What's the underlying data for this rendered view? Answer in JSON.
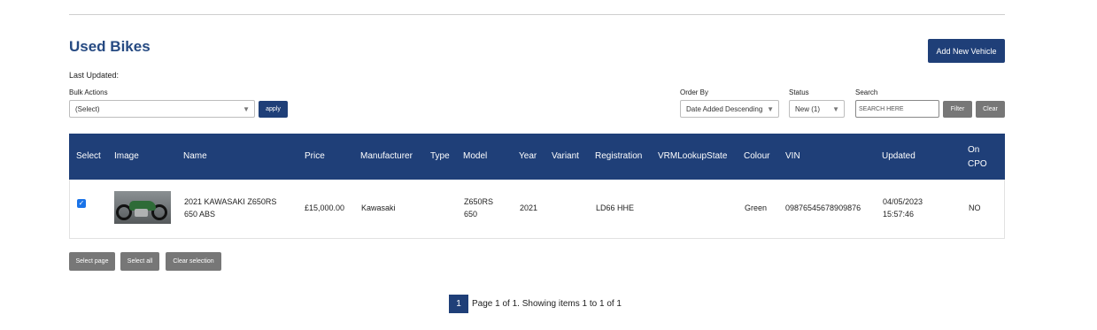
{
  "header": {
    "title": "Used Bikes",
    "add_button": "Add New Vehicle",
    "last_updated": "Last Updated:"
  },
  "filters": {
    "bulk_actions_label": "Bulk Actions",
    "bulk_actions_value": "(Select)",
    "apply_label": "apply",
    "order_by_label": "Order By",
    "order_by_value": "Date Added Descending",
    "status_label": "Status",
    "status_value": "New (1)",
    "search_label": "Search",
    "search_placeholder": "SEARCH HERE",
    "filter_button": "Filter",
    "clear_button": "Clear"
  },
  "table": {
    "columns": [
      "Select",
      "Image",
      "Name",
      "Price",
      "Manufacturer",
      "Type",
      "Model",
      "Year",
      "Variant",
      "Registration",
      "VRMLookupState",
      "Colour",
      "VIN",
      "Updated",
      "On\nCPO"
    ],
    "rows": [
      {
        "selected": true,
        "name": "2021 KAWASAKI Z650RS 650 ABS",
        "price": "£15,000.00",
        "manufacturer": "Kawasaki",
        "type": "",
        "model": "Z650RS 650",
        "year": "2021",
        "variant": "",
        "registration": "LD66 HHE",
        "vrm_lookup_state": "",
        "colour": "Green",
        "vin": "09876545678909876",
        "updated": "04/05/2023 15:57:46",
        "on_cpo": "NO"
      }
    ]
  },
  "selection_buttons": {
    "select_page": "Select page",
    "select_all": "Select all",
    "clear_selection": "Clear selection"
  },
  "pager": {
    "current_page": "1",
    "summary": "Page 1 of 1. Showing items 1 to 1 of 1"
  },
  "colors": {
    "brand_blue": "#1f3f78",
    "title_blue": "#264a82",
    "cpo_no_red": "#e0221c",
    "grey_button": "#777777"
  }
}
